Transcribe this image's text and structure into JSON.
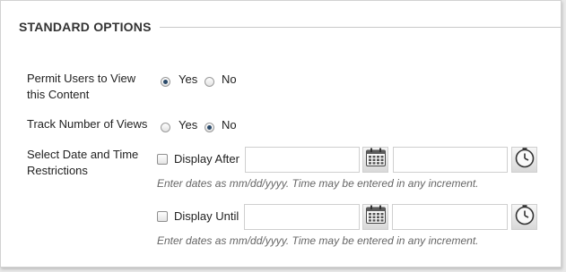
{
  "section": {
    "title": "STANDARD OPTIONS"
  },
  "permit_view": {
    "label_line1": "Permit Users to View",
    "label_line2": "this Content",
    "yes_label": "Yes",
    "no_label": "No",
    "selected": "Yes"
  },
  "track_views": {
    "label": "Track Number of Views",
    "yes_label": "Yes",
    "no_label": "No",
    "selected": "No"
  },
  "date_restrictions": {
    "label_line1": "Select Date and Time",
    "label_line2": "Restrictions",
    "display_after": {
      "label": "Display After",
      "checked": false,
      "date_value": "",
      "time_value": "",
      "calendar_icon": "calendar-icon",
      "clock_icon": "clock-icon",
      "hint": "Enter dates as mm/dd/yyyy. Time may be entered in any increment."
    },
    "display_until": {
      "label": "Display Until",
      "checked": false,
      "date_value": "",
      "time_value": "",
      "calendar_icon": "calendar-icon",
      "clock_icon": "clock-icon",
      "hint": "Enter dates as mm/dd/yyyy. Time may be entered in any increment."
    }
  },
  "colors": {
    "panel_bg": "#ffffff",
    "page_bg": "#e9e9e9",
    "radio_dot": "#2a4a6a",
    "hint_text": "#666666"
  }
}
